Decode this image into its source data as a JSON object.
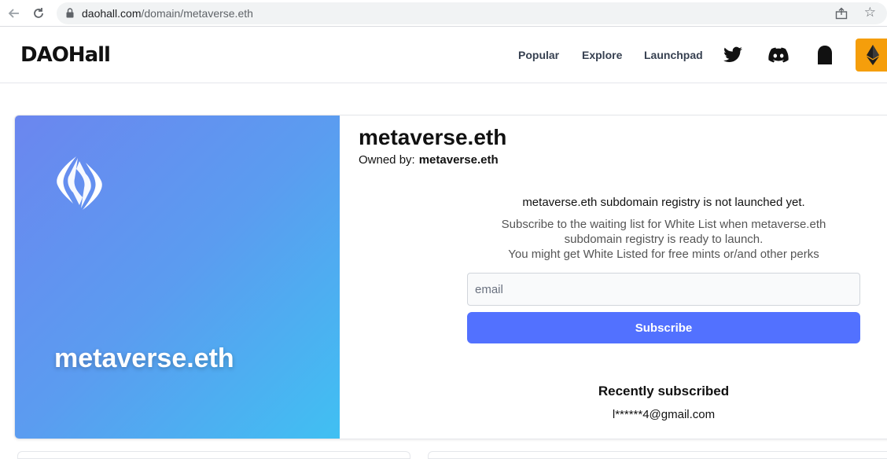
{
  "browser": {
    "url_host": "daohall.com",
    "url_path": "/domain/metaverse.eth"
  },
  "header": {
    "logo_text": "DAOHall",
    "nav": {
      "popular": "Popular",
      "explore": "Explore",
      "launchpad": "Launchpad"
    },
    "icons": [
      "twitter-icon",
      "discord-icon",
      "ghost-icon",
      "ethereum-icon"
    ],
    "eth_button_color": "#f59e0b"
  },
  "domain": {
    "image_name": "metaverse.eth",
    "title": "metaverse.eth",
    "owned_label": "Owned by:",
    "owner": "metaverse.eth",
    "gradient": [
      "#6b86ef",
      "#40c0f2"
    ]
  },
  "subscribe": {
    "notice": "metaverse.eth subdomain registry is not launched yet.",
    "line1": "Subscribe to the waiting list for White List when metaverse.eth",
    "line2": "subdomain registry is ready to launch.",
    "line3": "You might get White Listed for free mints or/and other perks",
    "email_placeholder": "email",
    "button_label": "Subscribe",
    "button_color": "#5271ff"
  },
  "recent": {
    "title": "Recently subscribed",
    "emails": [
      "l******4@gmail.com"
    ]
  }
}
